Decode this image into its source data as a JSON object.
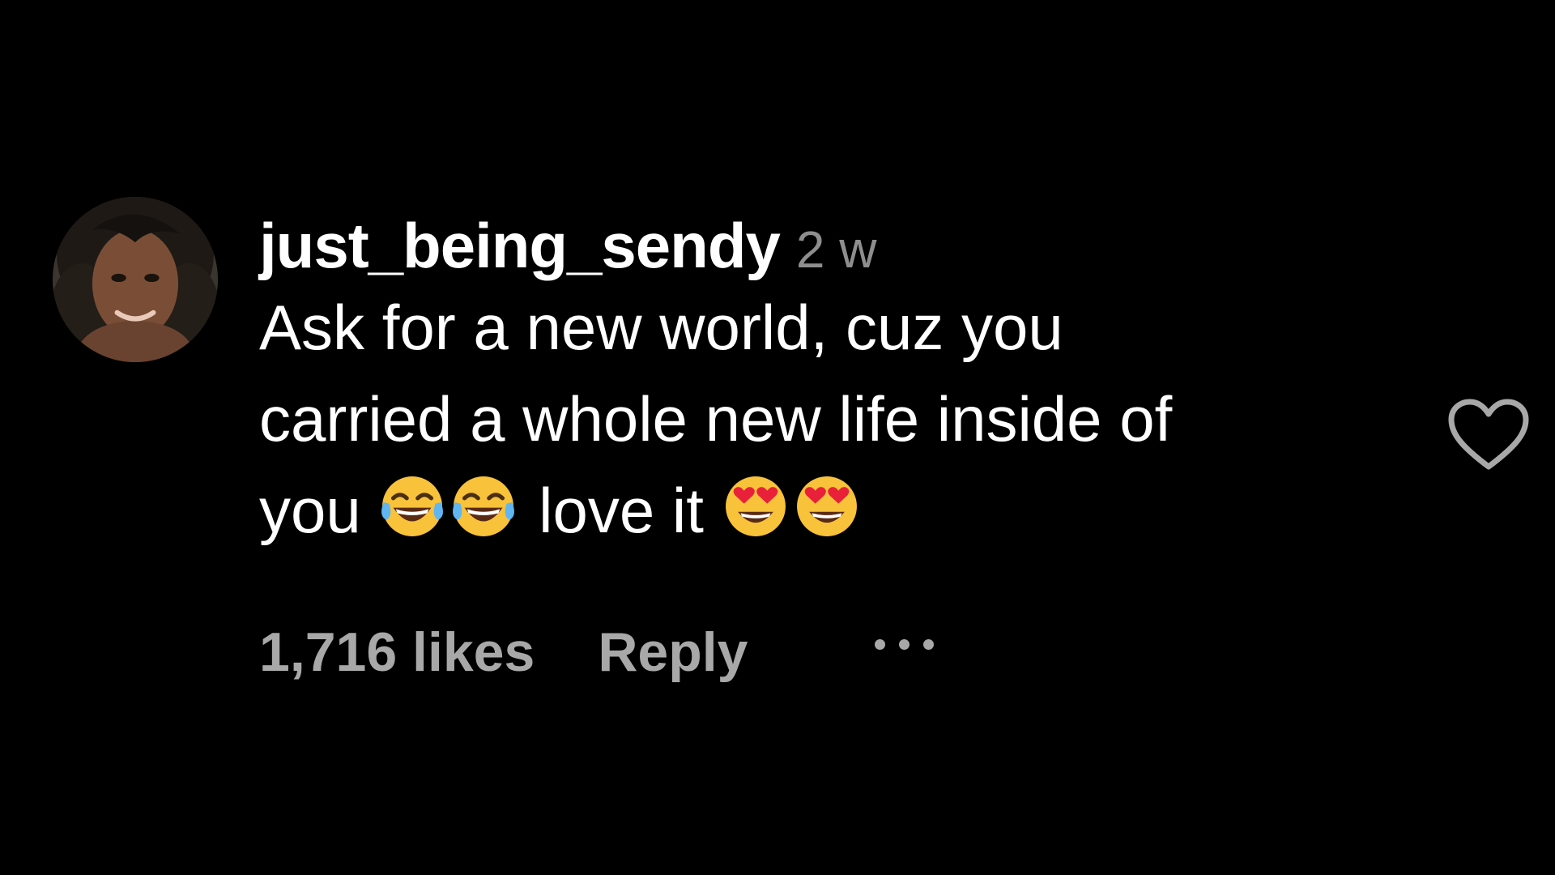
{
  "comment": {
    "username": "just_being_sendy",
    "time": "2 w",
    "text_line1": "Ask for a new world, cuz you",
    "text_line2": "carried a whole new life inside of",
    "text_line3_start": "you",
    "text_line3_mid": "love it",
    "emojis": [
      "face-with-tears-of-joy",
      "face-with-tears-of-joy",
      "smiling-face-with-heart-eyes",
      "smiling-face-with-heart-eyes"
    ]
  },
  "footer": {
    "likes": "1,716 likes",
    "reply": "Reply"
  },
  "icons": {
    "like": "heart-outline-icon",
    "more": "more-options-icon"
  },
  "colors": {
    "background": "#000000",
    "primary_text": "#ffffff",
    "secondary_text": "#8e8e8e",
    "footer_text": "#a8a8a8"
  }
}
